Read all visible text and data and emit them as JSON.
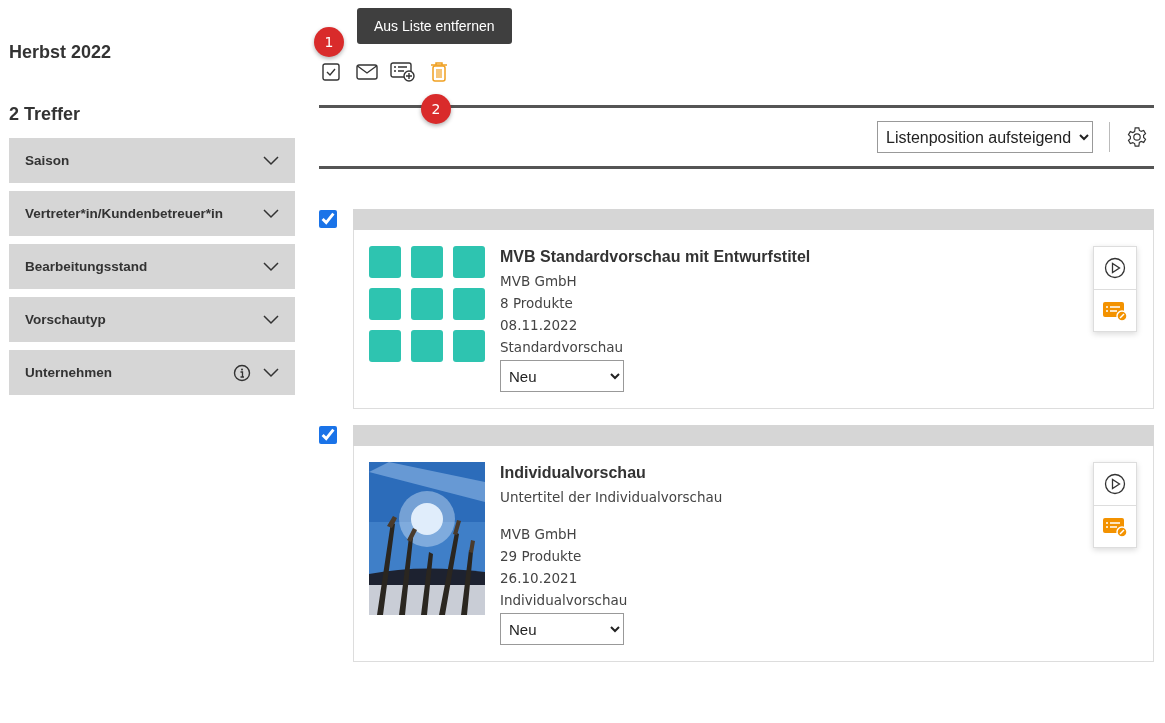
{
  "sidebar": {
    "title": "Herbst 2022",
    "hits": "2 Treffer",
    "filters": [
      {
        "label": "Saison",
        "info": false,
        "expanded": false
      },
      {
        "label": "Vertreter*in/Kundenbetreuer*in",
        "info": false,
        "expanded": false
      },
      {
        "label": "Bearbeitungsstand",
        "info": false,
        "expanded": false
      },
      {
        "label": "Vorschautyp",
        "info": false,
        "expanded": false
      },
      {
        "label": "Unternehmen",
        "info": true,
        "expanded": false
      }
    ]
  },
  "toolbar": {
    "tooltip": "Aus Liste entfernen",
    "badges": [
      "1",
      "2"
    ],
    "actions": [
      {
        "kind": "select-all",
        "active": false
      },
      {
        "kind": "mail",
        "active": false
      },
      {
        "kind": "add-list",
        "active": false
      },
      {
        "kind": "delete",
        "active": true
      }
    ]
  },
  "sort": {
    "value": "Listenposition aufsteigend"
  },
  "cards": [
    {
      "checked": true,
      "kind": "grid",
      "title": "MVB Standardvorschau mit Entwurfstitel",
      "lines": [
        "MVB GmbH",
        "8 Produkte",
        "08.11.2022",
        "Standardvorschau"
      ],
      "status": "Neu"
    },
    {
      "checked": true,
      "kind": "picture",
      "title": "Individualvorschau",
      "subtitle": "Untertitel der Individualvorschau",
      "lines": [
        "MVB GmbH",
        "29 Produkte",
        "26.10.2021",
        "Individualvorschau"
      ],
      "status": "Neu"
    }
  ]
}
